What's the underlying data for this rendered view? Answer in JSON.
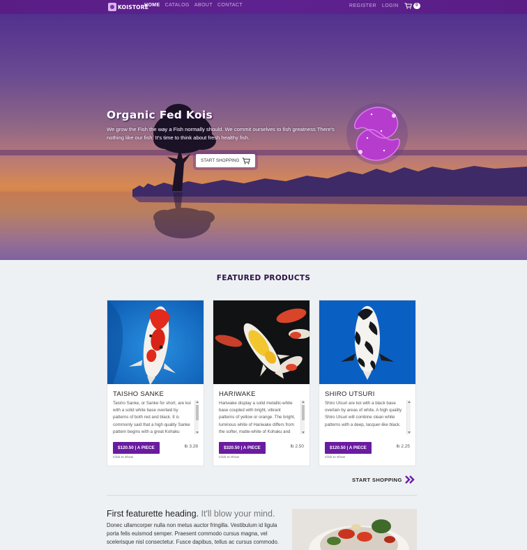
{
  "navbar": {
    "brand": "KOISTORE",
    "links": [
      "HOME",
      "CATALOG",
      "ABOUT",
      "CONTACT"
    ],
    "register": "REGISTER",
    "login": "LOGIN",
    "cart_count": "0"
  },
  "hero": {
    "title": "Organic Fed Kois",
    "subtitle": "We grow the Fish the way a Fish normally should. We commit ourselves to fish greatness There's nothing like our fish. It's time to think about fresh healthy fish.",
    "button": "START SHOPPING"
  },
  "featured": {
    "title": "FEATURED PRODUCTS",
    "products": [
      {
        "name": "TAISHO SANKE",
        "description": "Taisho Sanke, or Sanke for short, are koi with a solid white base overlaid by patterns of both red and black. It is commonly said that a high quality Sanke pattern begins with a great Kohaku",
        "price": "$120.50 | A PIECE",
        "weight": "lb 3.28",
        "link": "Click to Show"
      },
      {
        "name": "HARIWAKE",
        "description": "Hariwake display a solid metallic-white base coupled with bright, vibrant patterns of yellow or orange. The bright, luminous white of Hariwake differs from the softer, matte-white of Kohaku and",
        "price": "$320.50 | A PIECE",
        "weight": "lb 2.50",
        "link": "Click to Show"
      },
      {
        "name": "SHIRO UTSURI",
        "description": "Shiro Utsuri are koi with a black base overlain by areas of white. A high quality Shiro Utsuri will combine clean white patterns with a deep, lacquer-like black.",
        "price": "$120.50 | A PIECE",
        "weight": "lb 2.25",
        "link": "Click to Show"
      }
    ],
    "start_shopping": "START SHOPPING"
  },
  "featurette": {
    "heading": "First featurette heading.",
    "heading_muted": "It'll blow your mind.",
    "body": "Donec ullamcorper nulla non metus auctor fringilla. Vestibulum id ligula porta felis euismod semper. Praesent commodo cursus magna, vel scelerisque nisl consectetur. Fusce dapibus, tellus ac cursus commodo."
  },
  "colors": {
    "nav_bg": "#5a1d86",
    "accent": "#6a1ca0",
    "heading_dark": "#2c1246"
  }
}
